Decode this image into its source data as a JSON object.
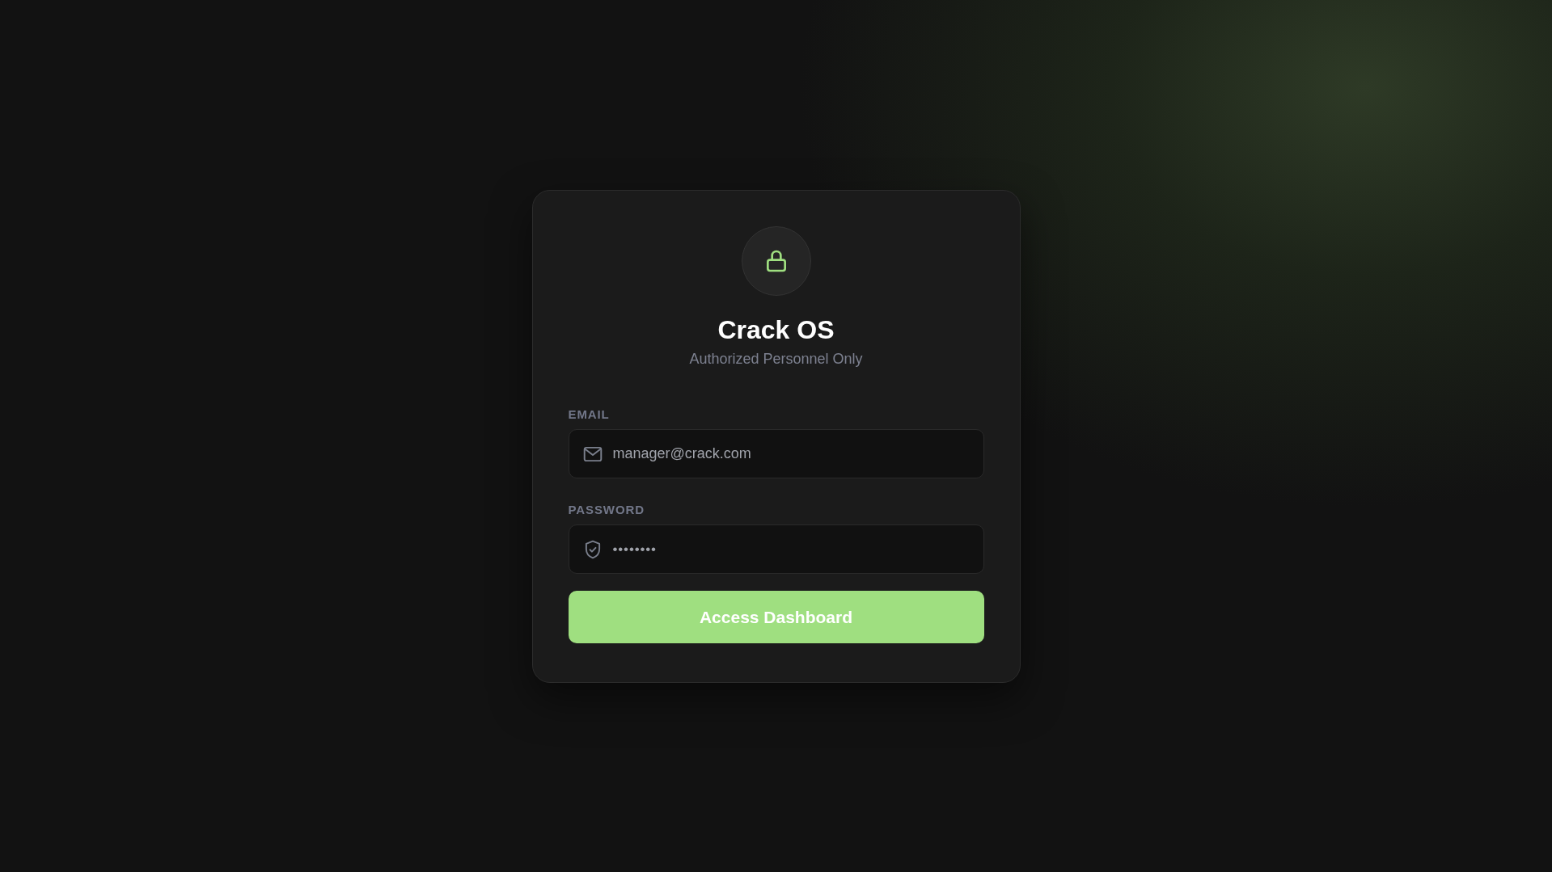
{
  "title": "Crack OS",
  "subtitle": "Authorized Personnel Only",
  "fields": [
    {
      "kind": "email",
      "label": "EMAIL",
      "value": "manager@crack.com"
    },
    {
      "kind": "password",
      "label": "PASSWORD",
      "value": "••••••••"
    }
  ],
  "button": "Access Dashboard"
}
